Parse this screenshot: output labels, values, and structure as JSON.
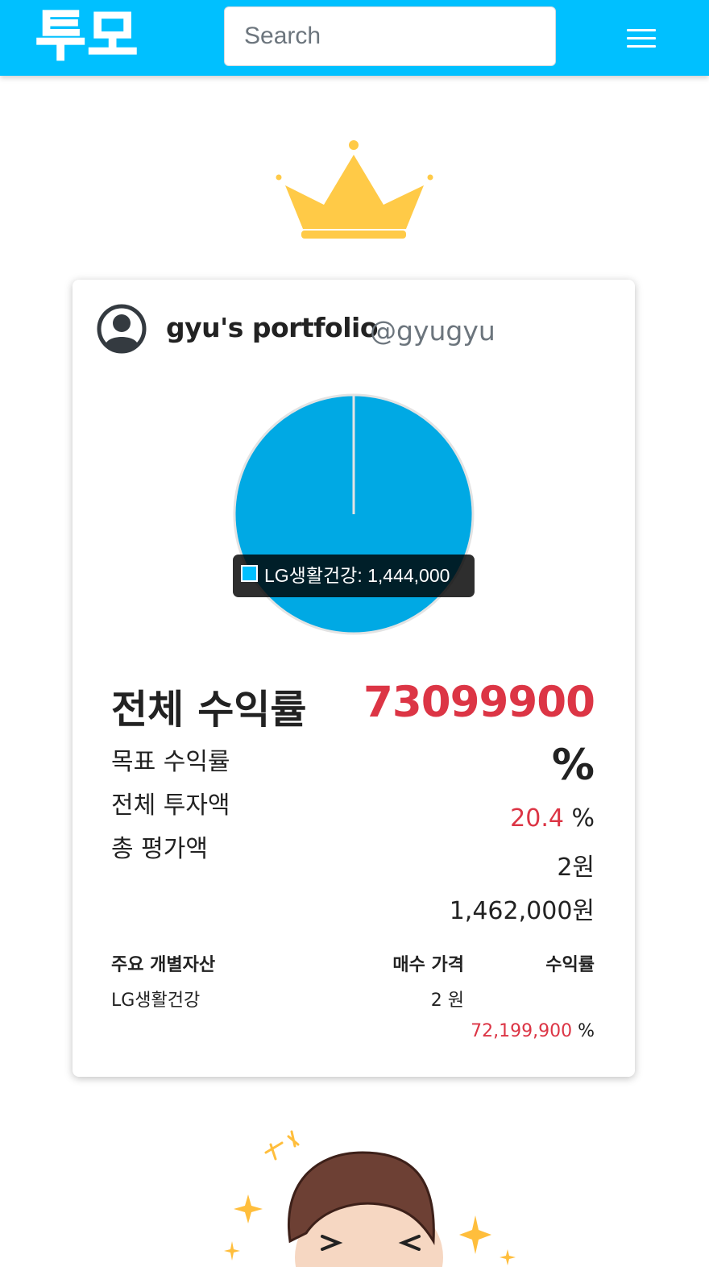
{
  "header": {
    "logo_text": "투모",
    "search_placeholder": "Search",
    "menu_icon": "hamburger-menu-icon",
    "brand_color": "#00c0ff"
  },
  "portfolio": {
    "title": "gyu's portfolio",
    "handle": "@gyugyu",
    "tooltip": {
      "label": "LG생활건강: 1,444,000"
    },
    "summary": {
      "total_return_label": "전체 수익률",
      "total_return_value": "73099900",
      "total_return_unit": "%",
      "target_return_label": "목표 수익률",
      "target_return_value": "20.4",
      "target_return_unit": "%",
      "total_investment_label": "전체 투자액",
      "total_investment_value": "2원",
      "total_valuation_label": "총 평가액",
      "total_valuation_value": "1,462,000원"
    },
    "assets": {
      "headers": [
        "주요 개별자산",
        "매수 가격",
        "수익률"
      ],
      "rows": [
        {
          "name": "LG생활건강",
          "price": "2 원",
          "return_value": "72,199,900",
          "return_unit": "%"
        }
      ]
    }
  },
  "chart_data": {
    "type": "pie",
    "labels": [
      "LG생활건강"
    ],
    "values": [
      1444000
    ],
    "colors": [
      "#00a9e4"
    ]
  },
  "colors": {
    "accent": "#00c0ff",
    "positive": "#dc3545",
    "crown": "#ffca47"
  }
}
